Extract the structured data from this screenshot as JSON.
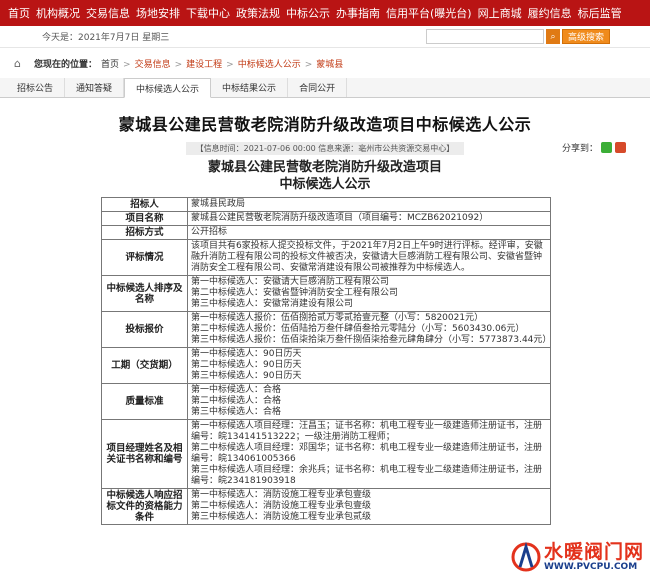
{
  "topnav": [
    "首页",
    "机构概况",
    "交易信息",
    "场地安排",
    "下载中心",
    "政策法规",
    "中标公示",
    "办事指南",
    "信用平台(曝光台)",
    "网上商城",
    "履约信息",
    "标后监管"
  ],
  "datebar": {
    "date": "今天是：2021年7月7日 星期三",
    "search_placeholder": "",
    "adv_label": "高级搜索"
  },
  "breadcrumb": {
    "label": "您现在的位置：",
    "items": [
      "首页",
      "交易信息",
      "建设工程",
      "中标候选人公示",
      "蒙城县"
    ]
  },
  "tabs": [
    "招标公告",
    "通知答疑",
    "中标候选人公示",
    "中标结果公示",
    "合同公开"
  ],
  "active_tab": 2,
  "title": "蒙城县公建民营敬老院消防升级改造项目中标候选人公示",
  "meta": "【信息时间：2021-07-06 00:00  信息来源：亳州市公共资源交易中心】",
  "share_label": "分享到：",
  "subtitle_line1": "蒙城县公建民营敬老院消防升级改造项目",
  "subtitle_line2": "中标候选人公示",
  "rows": [
    {
      "k": "招标人",
      "v": [
        "蒙城县民政局"
      ]
    },
    {
      "k": "项目名称",
      "v": [
        "蒙城县公建民营敬老院消防升级改造项目（项目编号：MCZB62021092）"
      ]
    },
    {
      "k": "招标方式",
      "v": [
        "公开招标"
      ]
    },
    {
      "k": "评标情况",
      "v": [
        "该项目共有6家投标人提交投标文件，于2021年7月2日上午9时进行评标。经评审，安徽融升消防工程有限公司的投标文件被否决，安徽请大巨感消防工程有限公司、安徽省暨钟消防安全工程有限公司、安徽常消建设有限公司被推荐为中标候选人。"
      ]
    },
    {
      "k": "中标候选人排序及名称",
      "v": [
        "第一中标候选人：安徽请大巨感消防工程有限公司",
        "第二中标候选人：安徽省暨钟消防安全工程有限公司",
        "第三中标候选人：安徽常消建设有限公司"
      ]
    },
    {
      "k": "投标报价",
      "v": [
        "第一中标候选人报价：伍佰捌拾贰万零贰拾壹元整（小写：5820021元）",
        "第二中标候选人报价：伍佰陆拾万叁仟肆佰叁拾元零陆分（小写：5603430.06元）",
        "第三中标候选人报价：伍佰柒拾柒万叁仟捌佰柒拾叁元肆角肆分（小写：5773873.44元）"
      ]
    },
    {
      "k": "工期（交货期）",
      "v": [
        "第一中标候选人：90日历天",
        "第二中标候选人：90日历天",
        "第三中标候选人：90日历天"
      ]
    },
    {
      "k": "质量标准",
      "v": [
        "第一中标候选人：合格",
        "第二中标候选人：合格",
        "第三中标候选人：合格"
      ]
    },
    {
      "k": "项目经理姓名及相关证书名称和编号",
      "v": [
        "第一中标候选人项目经理：汪昌玉；证书名称：机电工程专业一级建造师注册证书，注册编号：皖134141513222；一级注册消防工程师；",
        "第二中标候选人项目经理：邓国华；证书名称：机电工程专业一级建造师注册证书，注册编号：皖134061005366",
        "第三中标候选人项目经理：余兆兵；证书名称：机电工程专业二级建造师注册证书，注册编号：皖234181903918"
      ]
    },
    {
      "k": "中标候选人响应招标文件的资格能力条件",
      "v": [
        "第一中标候选人：消防设施工程专业承包壹级",
        "第二中标候选人：消防设施工程专业承包壹级",
        "第三中标候选人：消防设施工程专业承包贰级"
      ]
    }
  ],
  "watermark": {
    "cn": "水暖阀门网",
    "url": "WWW.PVCPU.COM"
  },
  "colors": {
    "nav": "#b91414",
    "accent": "#f08b1c",
    "link": "#c23a14"
  }
}
